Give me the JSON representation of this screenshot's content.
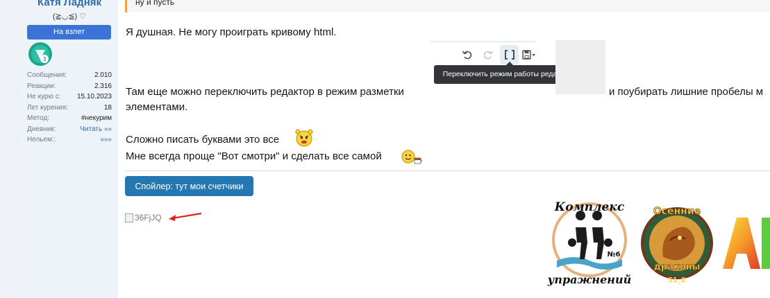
{
  "user": {
    "name": "Катя Ладняк",
    "title": "(≧◡≦) ♡",
    "banner": "На взлет",
    "stats": [
      {
        "label": "Сообщения:",
        "value": "2.010"
      },
      {
        "label": "Реакции:",
        "value": "2.316"
      },
      {
        "label": "Не курю с:",
        "value": "15.10.2023"
      },
      {
        "label": "Лет курения:",
        "value": "18"
      },
      {
        "label": "Метод:",
        "value": "#некурим"
      },
      {
        "label": "Дневник:",
        "value": "Читать »»"
      },
      {
        "label": "Нельем::",
        "value": "»»»"
      }
    ]
  },
  "quote": {
    "text": "ну и пусть"
  },
  "post": {
    "line1": "Я душная. Не могу проиграть кривому html.",
    "line2a": "Там еще можно переключить редактор в режим разметки",
    "line2b": "и поубирать лишние пробелы м",
    "line3": "элементами.",
    "line4": "Сложно писать буквами это все",
    "line5": "Мне всегда проще \"Вот смотри\" и сделать все самой"
  },
  "editor": {
    "tooltip": "Переключить режим работы редактора",
    "icons": [
      "undo-icon",
      "redo-icon",
      "toggle-bbcode-icon",
      "save-draft-icon"
    ]
  },
  "spoiler": {
    "label": "Спойлер: тут мои счетчики"
  },
  "broken_image": {
    "alt": "36FjJQ"
  },
  "logos": {
    "logo1_top": "Комплекс",
    "logo1_bottom": "упражнений",
    "logo1_badge": "№6",
    "logo2_top": "Осенние",
    "logo2_bottom": "драконы",
    "logo2_num": "51_2"
  },
  "colors": {
    "accent": "#2577b1",
    "banner": "#3b74d8",
    "quote_border": "#f3a445",
    "arrow": "#e0241b"
  }
}
